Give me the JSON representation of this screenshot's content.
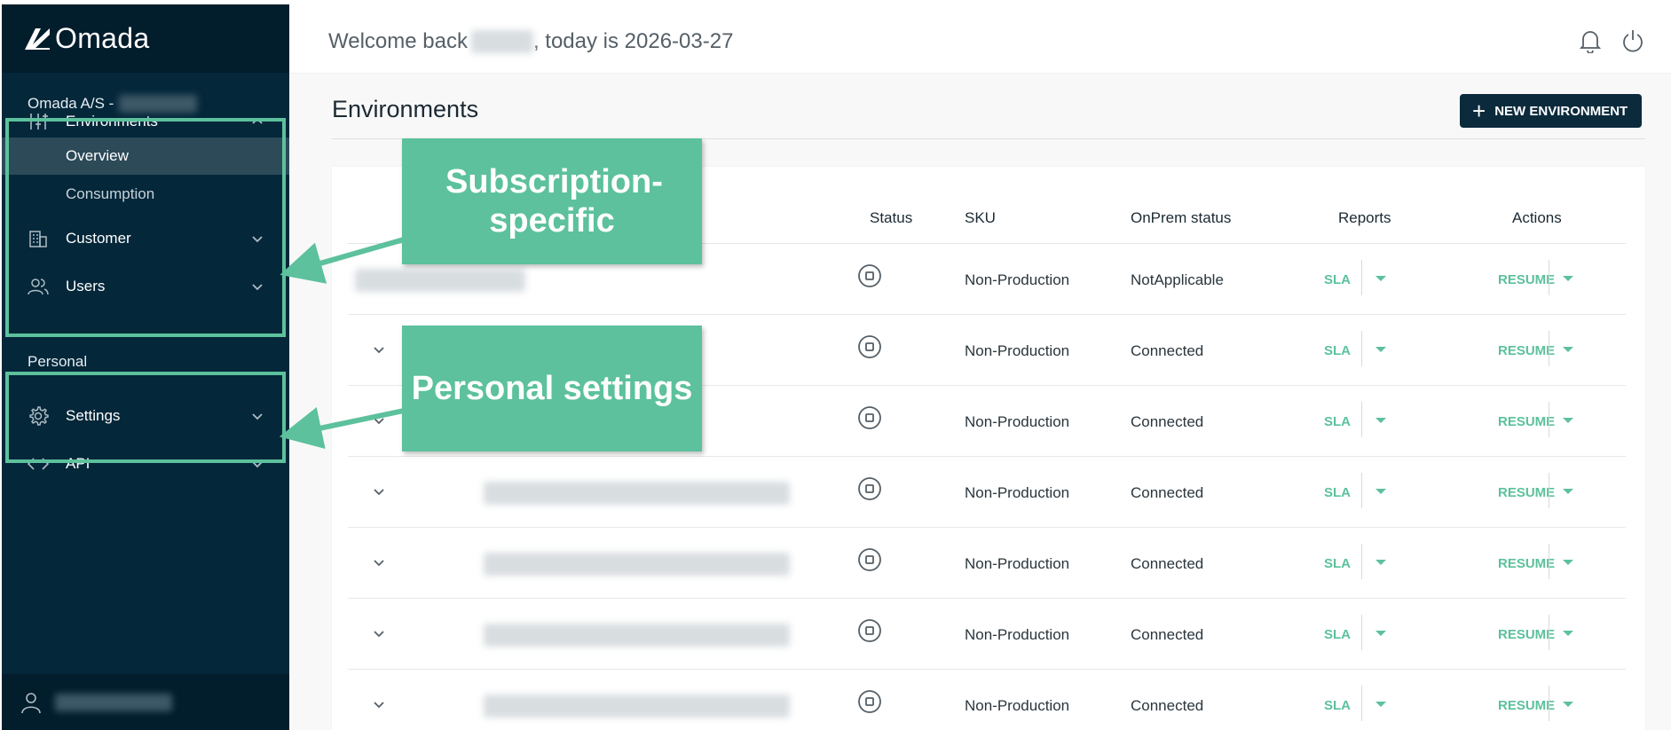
{
  "sidebar": {
    "logo_text": "Omada",
    "org_label": "Omada A/S -",
    "nav": {
      "environments": "Environments",
      "overview": "Overview",
      "consumption": "Consumption",
      "customer": "Customer",
      "users": "Users"
    },
    "personal_label": "Personal",
    "personal_nav": {
      "settings": "Settings",
      "api": "API"
    }
  },
  "header": {
    "welcome_prefix": "Welcome back",
    "welcome_suffix": ", today is 2026-03-27"
  },
  "page": {
    "title": "Environments",
    "new_env_plus": "+",
    "new_env_label": "NEW ENVIRONMENT"
  },
  "table": {
    "columns": {
      "status": "Status",
      "sku": "SKU",
      "onprem": "OnPrem status",
      "reports": "Reports",
      "actions": "Actions"
    },
    "rows": [
      {
        "sku": "Non-Production",
        "onprem": "NotApplicable",
        "report": "SLA",
        "action": "RESUME"
      },
      {
        "sku": "Non-Production",
        "onprem": "Connected",
        "report": "SLA",
        "action": "RESUME"
      },
      {
        "sku": "Non-Production",
        "onprem": "Connected",
        "report": "SLA",
        "action": "RESUME"
      },
      {
        "sku": "Non-Production",
        "onprem": "Connected",
        "report": "SLA",
        "action": "RESUME"
      },
      {
        "sku": "Non-Production",
        "onprem": "Connected",
        "report": "SLA",
        "action": "RESUME"
      },
      {
        "sku": "Non-Production",
        "onprem": "Connected",
        "report": "SLA",
        "action": "RESUME"
      },
      {
        "sku": "Non-Production",
        "onprem": "Connected",
        "report": "SLA",
        "action": "RESUME"
      }
    ]
  },
  "callouts": {
    "subscription": "Subscription-specific",
    "personal": "Personal settings"
  },
  "colors": {
    "sidebar_bg": "#04273a",
    "accent_green": "#5cc19c",
    "button_dark": "#0b2a3c"
  },
  "icons": [
    "sliders-icon",
    "chevron-up-icon",
    "chevron-down-icon",
    "building-icon",
    "users-icon",
    "gear-icon",
    "code-icon",
    "user-icon",
    "bell-icon",
    "power-icon",
    "status-stop-icon"
  ]
}
